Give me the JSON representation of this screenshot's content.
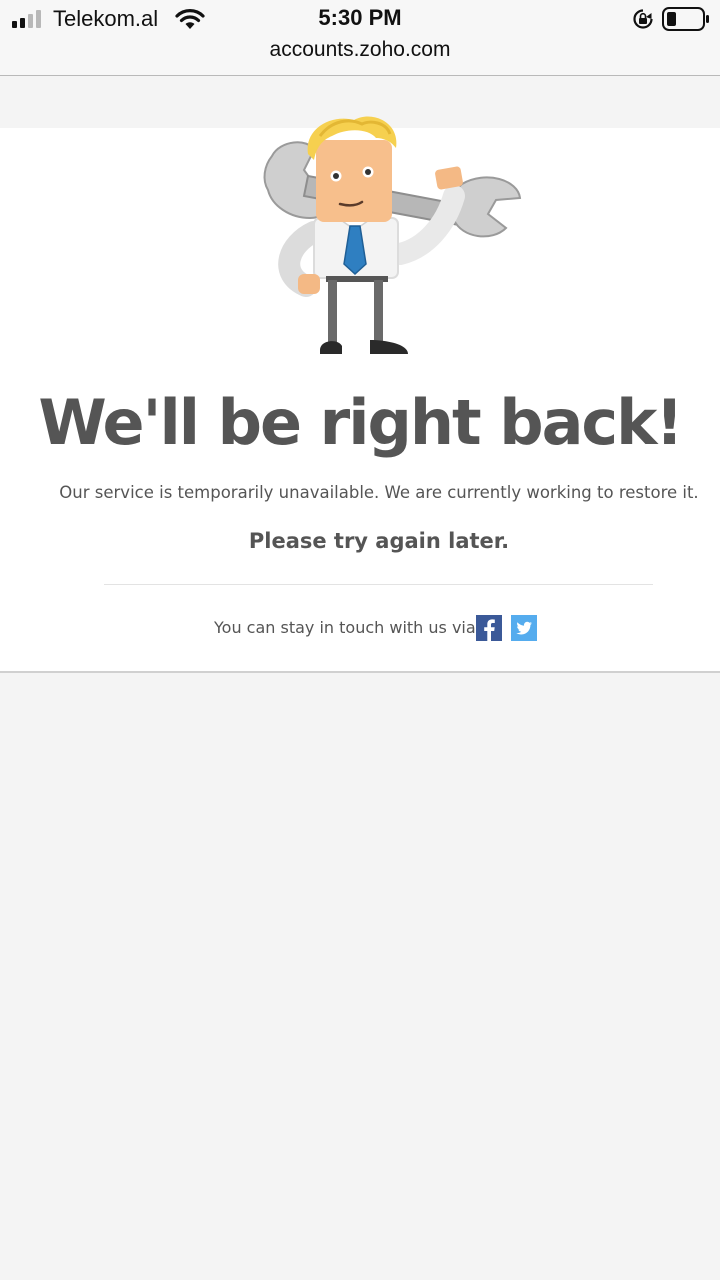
{
  "status_bar": {
    "carrier": "Telekom.al",
    "time": "5:30 PM",
    "signal_bars": 2,
    "battery_level": 0.25
  },
  "browser": {
    "url": "accounts.zoho.com"
  },
  "page": {
    "headline": "We'll be right back!",
    "message": "Our service is temporarily unavailable. We are currently working to restore it.",
    "retry": "Please try again later.",
    "social_text": "You can stay in touch with us via",
    "social": [
      {
        "icon": "facebook-icon",
        "color": "#3b5998"
      },
      {
        "icon": "twitter-icon",
        "color": "#55acee"
      }
    ]
  },
  "colors": {
    "text": "#555555",
    "background": "#f4f4f4",
    "card": "#ffffff"
  }
}
